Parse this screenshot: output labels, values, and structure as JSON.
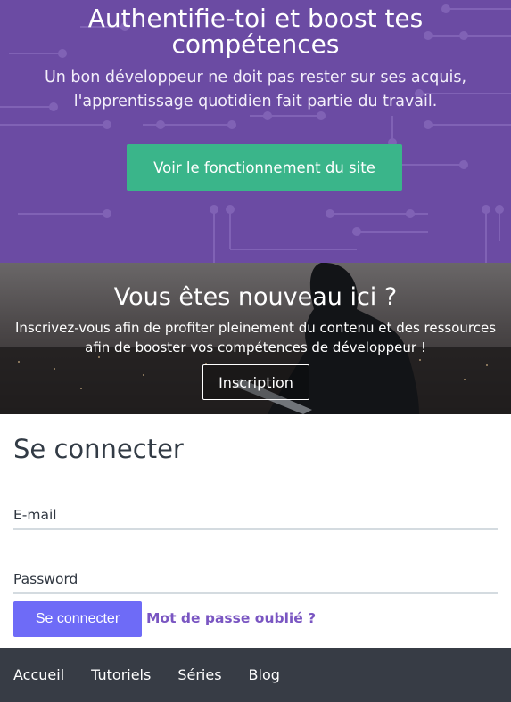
{
  "hero": {
    "title": "Authentifie-toi et boost tes compétences",
    "subtitle": "Un bon développeur ne doit pas rester sur ses acquis, l'apprentissage quotidien fait partie du travail.",
    "button_label": "Voir le fonctionnement du site",
    "background_color": "#6b4ba3",
    "button_color": "#3ab58a"
  },
  "signup_banner": {
    "title": "Vous êtes nouveau ici ?",
    "text": "Inscrivez-vous afin de profiter pleinement du contenu et des ressources afin de booster vos compétences de développeur !",
    "button_label": "Inscription"
  },
  "login": {
    "title": "Se connecter",
    "email_label": "E-mail",
    "email_value": "",
    "password_label": "Password",
    "password_value": "",
    "submit_label": "Se connecter",
    "forgot_label": "Mot de passe oublié ?",
    "submit_color": "#6e6bf7",
    "link_color": "#7a56c2"
  },
  "footer": {
    "links": [
      "Accueil",
      "Tutoriels",
      "Séries",
      "Blog"
    ],
    "background_color": "#373c45"
  }
}
